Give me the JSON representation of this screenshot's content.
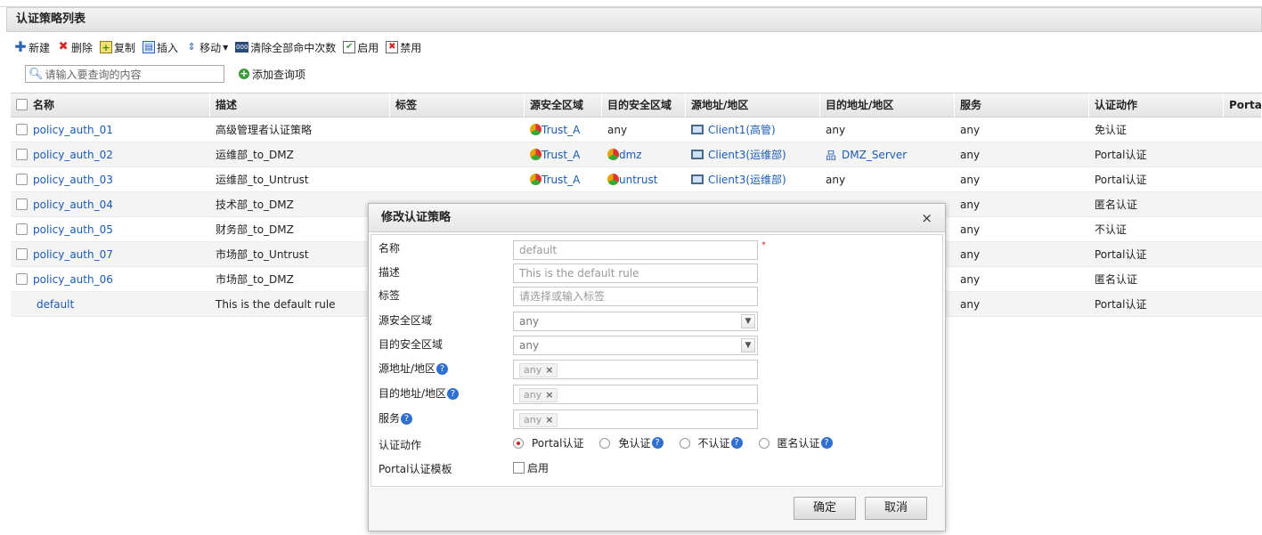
{
  "title": "认证策略列表",
  "toolbar": {
    "new": "新建",
    "delete": "删除",
    "copy": "复制",
    "insert": "插入",
    "move": "移动",
    "clear_hits": "清除全部命中次数",
    "enable": "启用",
    "disable": "禁用"
  },
  "search": {
    "placeholder": "请输入要查询的内容",
    "add_query": "添加查询项"
  },
  "table": {
    "headers": [
      "名称",
      "描述",
      "标签",
      "源安全区域",
      "目的安全区域",
      "源地址/地区",
      "目的地址/地区",
      "服务",
      "认证动作",
      "Portal认"
    ],
    "rows": [
      {
        "name": "policy_auth_01",
        "desc": "高级管理者认证策略",
        "tag": "",
        "src_zone": "Trust_A",
        "dst_zone": "any",
        "src_addr": "Client1(高管)",
        "dst_addr": "any",
        "service": "any",
        "action": "免认证"
      },
      {
        "name": "policy_auth_02",
        "desc": "运维部_to_DMZ",
        "tag": "",
        "src_zone": "Trust_A",
        "dst_zone": "dmz",
        "src_addr": "Client3(运维部)",
        "dst_addr": "DMZ_Server",
        "service": "any",
        "action": "Portal认证"
      },
      {
        "name": "policy_auth_03",
        "desc": "运维部_to_Untrust",
        "tag": "",
        "src_zone": "Trust_A",
        "dst_zone": "untrust",
        "src_addr": "Client3(运维部)",
        "dst_addr": "any",
        "service": "any",
        "action": "Portal认证"
      },
      {
        "name": "policy_auth_04",
        "desc": "技术部_to_DMZ",
        "tag": "",
        "src_zone": "",
        "dst_zone": "",
        "src_addr": "",
        "dst_addr": "",
        "service": "any",
        "action": "匿名认证"
      },
      {
        "name": "policy_auth_05",
        "desc": "财务部_to_DMZ",
        "tag": "",
        "src_zone": "",
        "dst_zone": "",
        "src_addr": "",
        "dst_addr": "",
        "service": "any",
        "action": "不认证"
      },
      {
        "name": "policy_auth_07",
        "desc": "市场部_to_Untrust",
        "tag": "",
        "src_zone": "",
        "dst_zone": "",
        "src_addr": "",
        "dst_addr": "",
        "service": "any",
        "action": "Portal认证"
      },
      {
        "name": "policy_auth_06",
        "desc": "市场部_to_DMZ",
        "tag": "",
        "src_zone": "",
        "dst_zone": "",
        "src_addr": "",
        "dst_addr": "",
        "service": "any",
        "action": "匿名认证"
      },
      {
        "name": "default",
        "desc": "This is the default rule",
        "tag": "",
        "src_zone": "",
        "dst_zone": "",
        "src_addr": "",
        "dst_addr": "",
        "service": "any",
        "action": "Portal认证"
      }
    ]
  },
  "dialog": {
    "title": "修改认证策略",
    "close": "×",
    "labels": {
      "name": "名称",
      "desc": "描述",
      "tag": "标签",
      "src_zone": "源安全区域",
      "dst_zone": "目的安全区域",
      "src_addr": "源地址/地区",
      "dst_addr": "目的地址/地区",
      "service": "服务",
      "action": "认证动作",
      "portal_tpl": "Portal认证模板"
    },
    "values": {
      "name": "default",
      "desc": "This is the default rule",
      "tag_placeholder": "请选择或输入标签",
      "src_zone": "any",
      "dst_zone": "any",
      "src_addr_chip": "any",
      "dst_addr_chip": "any",
      "service_chip": "any"
    },
    "required_mark": "*",
    "help": "?",
    "chip_remove": "×",
    "actions": {
      "portal": "Portal认证",
      "exempt": "免认证",
      "none": "不认证",
      "anonymous": "匿名认证"
    },
    "portal_enable": "启用",
    "ok": "确定",
    "cancel": "取消"
  }
}
